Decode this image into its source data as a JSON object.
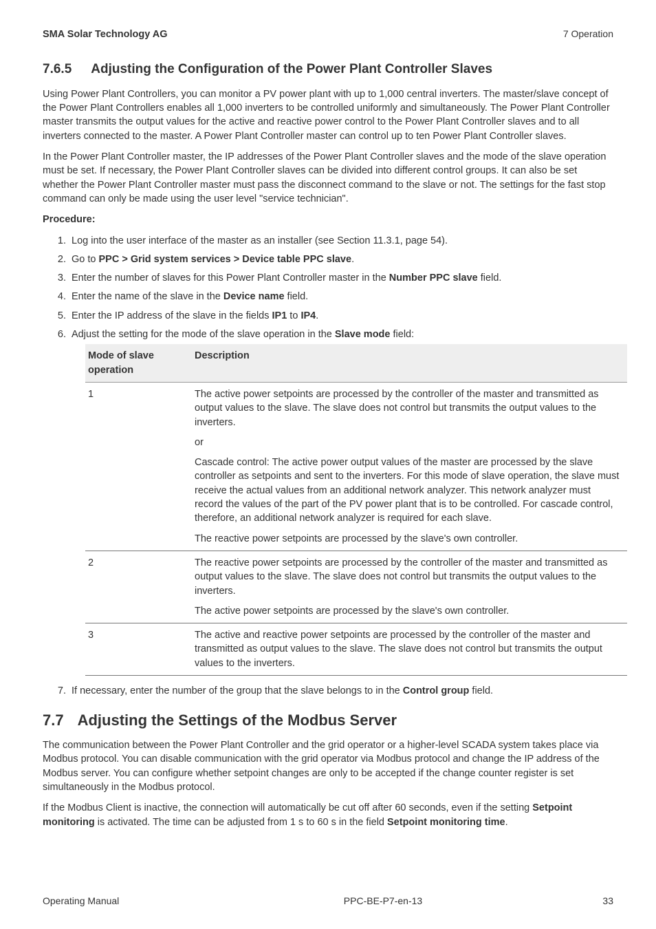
{
  "header": {
    "left": "SMA Solar Technology AG",
    "right": "7  Operation"
  },
  "sec765": {
    "num": "7.6.5",
    "title": "Adjusting the Configuration of the Power Plant Controller Slaves",
    "p1": "Using Power Plant Controllers, you can monitor a PV power plant with up to 1,000 central inverters. The master/slave concept of the Power Plant Controllers enables all 1,000 inverters to be controlled uniformly and simultaneously. The Power Plant Controller master transmits the output values for the active and reactive power control to the Power Plant Controller slaves and to all inverters connected to the master. A Power Plant Controller master can control up to ten Power Plant Controller slaves.",
    "p2": "In the Power Plant Controller master, the IP addresses of the Power Plant Controller slaves and the mode of the slave operation must be set. If necessary, the Power Plant Controller slaves can be divided into different control groups. It can also be set whether the Power Plant Controller master must pass the disconnect command to the slave or not. The settings for the fast stop command can only be made using the user level \"service technician\".",
    "proc_label": "Procedure:",
    "steps": {
      "s1": "Log into the user interface of the master as an installer (see Section 11.3.1, page 54).",
      "s2a": "Go to ",
      "s2b": "PPC > Grid system services > Device table PPC slave",
      "s2c": ".",
      "s3a": "Enter the number of slaves for this Power Plant Controller master in the ",
      "s3b": "Number PPC slave",
      "s3c": " field.",
      "s4a": "Enter the name of the slave in the ",
      "s4b": "Device name",
      "s4c": " field.",
      "s5a": "Enter the IP address of the slave in the fields ",
      "s5b": "IP1",
      "s5c": " to ",
      "s5d": "IP4",
      "s5e": ".",
      "s6a": "Adjust the setting for the mode of the slave operation in the ",
      "s6b": "Slave mode",
      "s6c": " field:",
      "s7a": "If necessary, enter the number of the group that the slave belongs to in the ",
      "s7b": "Control group",
      "s7c": " field."
    },
    "table": {
      "h1": "Mode of slave operation",
      "h2": "Description",
      "r1": {
        "mode": "1",
        "p1": "The active power setpoints are processed by the controller of the master and transmitted as output values to the slave. The slave does not control but transmits the output values to the inverters.",
        "p2": "or",
        "p3": "Cascade control: The active power output values of the master are processed by the slave controller as setpoints and sent to the inverters. For this mode of slave operation, the slave must receive the actual values from an additional network analyzer. This network analyzer must record the values of the part of the PV power plant that is to be controlled. For cascade control, therefore, an additional network analyzer is required for each slave.",
        "p4": "The reactive power setpoints are processed by the slave's own controller."
      },
      "r2": {
        "mode": "2",
        "p1": "The reactive power setpoints are processed by the controller of the master and transmitted as output values to the slave. The slave does not control but transmits the output values to the inverters.",
        "p2": "The active power setpoints are processed by the slave's own controller."
      },
      "r3": {
        "mode": "3",
        "p1": "The active and reactive power setpoints are processed by the controller of the master and transmitted as output values to the slave. The slave does not control but transmits the output values to the inverters."
      }
    }
  },
  "sec77": {
    "num": "7.7",
    "title": "Adjusting the Settings of the Modbus Server",
    "p1": "The communication between the Power Plant Controller and the grid operator or a higher-level SCADA system takes place via Modbus protocol. You can disable communication with the grid operator via Modbus protocol and change the IP address of the Modbus server. You can configure whether setpoint changes are only to be accepted if the change counter register is set simultaneously in the Modbus protocol.",
    "p2a": "If the Modbus Client is inactive, the connection will automatically be cut off after 60 seconds, even if the setting ",
    "p2b": "Setpoint monitoring",
    "p2c": " is activated. The time can be adjusted from 1 s to 60 s in the field ",
    "p2d": "Setpoint monitoring time",
    "p2e": "."
  },
  "footer": {
    "left": "Operating Manual",
    "mid": "PPC-BE-P7-en-13",
    "page": "33"
  }
}
